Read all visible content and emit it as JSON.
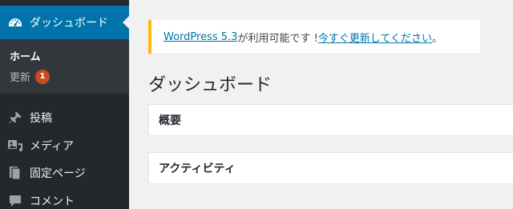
{
  "sidebar": {
    "dashboard_label": "ダッシュボード",
    "submenu": {
      "home_label": "ホーム",
      "update_label": "更新",
      "update_count": "1"
    },
    "items": [
      {
        "label": "投稿",
        "icon": "pushpin-icon"
      },
      {
        "label": "メディア",
        "icon": "media-icon"
      },
      {
        "label": "固定ページ",
        "icon": "pages-icon"
      },
      {
        "label": "コメント",
        "icon": "comment-icon"
      }
    ]
  },
  "notice": {
    "link_version": "WordPress 5.3",
    "text": " が利用可能です ! ",
    "link_update": "今すぐ更新してください",
    "end": "。"
  },
  "main": {
    "title": "ダッシュボード",
    "boxes": [
      "概要",
      "アクティビティ"
    ]
  },
  "colors": {
    "sidebar_bg": "#23282d",
    "submenu_bg": "#32373c",
    "active_bg": "#0073aa",
    "notice_border": "#ffb900",
    "badge_bg": "#ca4a1f",
    "link": "#0073aa"
  }
}
